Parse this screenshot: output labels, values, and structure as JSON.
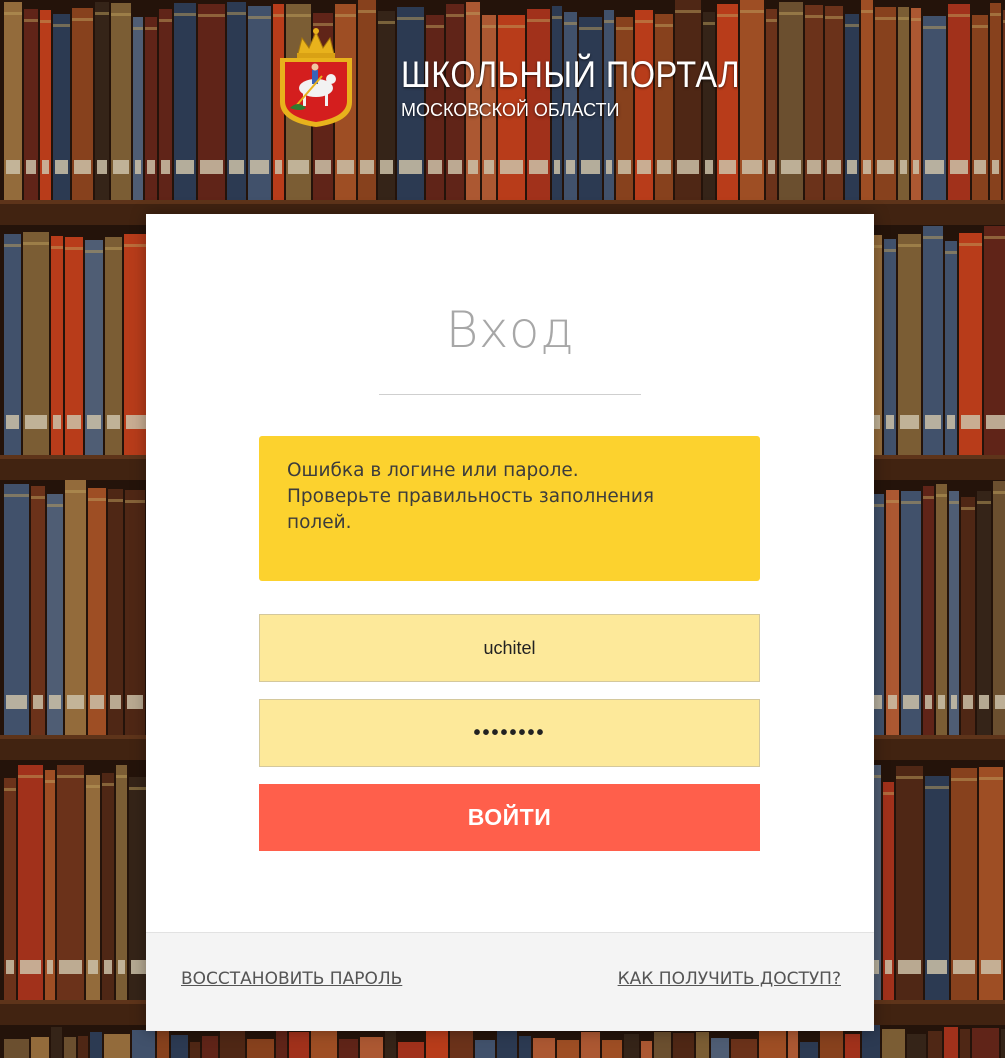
{
  "header": {
    "title": "ШКОЛЬНЫЙ ПОРТАЛ",
    "subtitle": "МОСКОВСКОЙ ОБЛАСТИ",
    "logo": "moscow-oblast-coat-of-arms"
  },
  "login": {
    "title": "Вход",
    "error_lines": [
      "Ошибка в логине или пароле.",
      "Проверьте правильность заполнения",
      "полей."
    ],
    "username_value": "uchitel",
    "password_value": "••••••••",
    "submit_label": "ВОЙТИ"
  },
  "footer": {
    "restore_link": "ВОССТАНОВИТЬ ПАРОЛЬ",
    "access_link": "КАК ПОЛУЧИТЬ ДОСТУП?"
  },
  "colors": {
    "alert_bg": "#fcd22e",
    "field_bg": "#fde99a",
    "submit_bg": "#ff5f4b",
    "card_bg": "#ffffff"
  }
}
